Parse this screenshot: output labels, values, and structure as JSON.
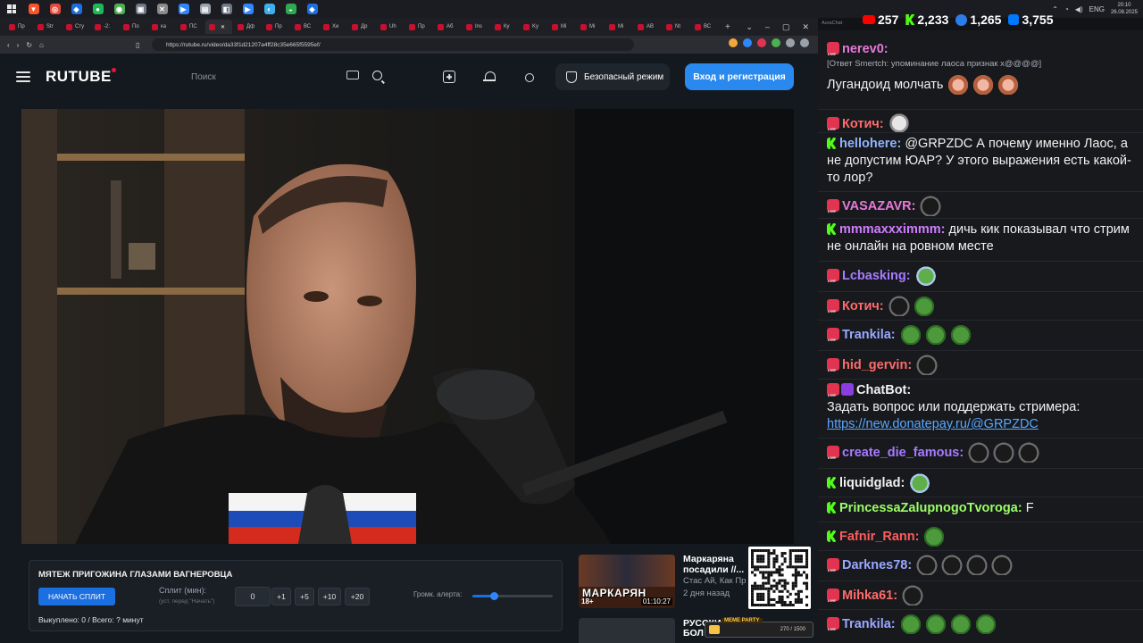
{
  "taskbar": {
    "apps": [
      {
        "glyph": "▼",
        "color": "#fb542b"
      },
      {
        "glyph": "◎",
        "color": "#e64a3b"
      },
      {
        "glyph": "◆",
        "color": "#1c6fe0"
      },
      {
        "glyph": "●",
        "color": "#1db954"
      },
      {
        "glyph": "◉",
        "color": "#4cb050"
      },
      {
        "glyph": "▣",
        "color": "#6f7885"
      },
      {
        "glyph": "✕",
        "color": "#8a8a8a"
      },
      {
        "glyph": "▶",
        "color": "#2f86ff"
      },
      {
        "glyph": "▤",
        "color": "#9aa1aa"
      },
      {
        "glyph": "◧",
        "color": "#6f7885"
      },
      {
        "glyph": "▶",
        "color": "#2f86ff"
      },
      {
        "glyph": "◐",
        "color": "#3db0f0"
      },
      {
        "glyph": "◒",
        "color": "#2fa84f"
      },
      {
        "glyph": "◆",
        "color": "#1c6fe0"
      }
    ],
    "lang": "ENG",
    "time": "20:10",
    "date": "26.08.2025"
  },
  "tabs": [
    {
      "label": "Пр"
    },
    {
      "label": "Str"
    },
    {
      "label": "Сту"
    },
    {
      "label": "-2:"
    },
    {
      "label": "По"
    },
    {
      "label": "ка"
    },
    {
      "label": "ПС"
    },
    {
      "label": "",
      "active": true
    },
    {
      "label": "Дф"
    },
    {
      "label": "Пр"
    },
    {
      "label": "ВС"
    },
    {
      "label": "Хи"
    },
    {
      "label": "Др"
    },
    {
      "label": "Uh"
    },
    {
      "label": "Пр"
    },
    {
      "label": "Аб"
    },
    {
      "label": "Ins"
    },
    {
      "label": "Ку"
    },
    {
      "label": "Kу"
    },
    {
      "label": "Мі"
    },
    {
      "label": "Мі"
    },
    {
      "label": "Мі"
    },
    {
      "label": "АВ"
    },
    {
      "label": "Nt"
    },
    {
      "label": "ВС"
    }
  ],
  "address": {
    "url": "https://rutube.ru/video/da33f1d21207a4ff28c35e665f5595ef/"
  },
  "header": {
    "logo": "RUTUBE",
    "search_placeholder": "Поиск",
    "safe_mode_label": "Безопасный режим",
    "login_label": "Вход и регистрация"
  },
  "split": {
    "title": "МЯТЕЖ ПРИГОЖИНА ГЛАЗАМИ ВАГНЕРОВЦА",
    "start_label": "НАЧАТЬ СПЛИТ",
    "minutes_label": "Сплит (мин):",
    "minutes_hint": "(уст. перед \"Начать\")",
    "minutes_value": "0",
    "increments": [
      "+1",
      "+5",
      "+10",
      "+20"
    ],
    "volume_label": "Громк. алерта:",
    "volume_fraction": 0.27,
    "status": "Выкуплено: 0 / Всего: ? минут"
  },
  "recommended": [
    {
      "title": "Маркаряна посадили //...",
      "channel": "Стас Ай, Как Пр",
      "date": "2 дня назад",
      "thumb_text": "МАРКАРЯН",
      "age": "18+",
      "duration": "01:10:27"
    },
    {
      "title": "РУССКИ БОЛ",
      "thumb_text": ""
    }
  ],
  "party": {
    "label": "MEME PARTY",
    "count": "270 / 1500"
  },
  "chat": {
    "app_label": "AuraChat",
    "stats": [
      {
        "platform": "youtube",
        "value": "257"
      },
      {
        "platform": "kick",
        "value": "2,233"
      },
      {
        "platform": "vk",
        "value": "1,265"
      },
      {
        "platform": "twitch",
        "value": "3,755"
      }
    ],
    "messages": [
      {
        "badge": "live",
        "user": "nerev0:",
        "color": "#e77ad8",
        "reply": "[Ответ Smertch: упоминание лаоса признак х@@@@]",
        "text": "Лугандоид молчать",
        "emotes": [
          "monkey",
          "monkey",
          "monkey"
        ]
      },
      {
        "badge": "live",
        "user": "Котич:",
        "color": "#ff6b6b",
        "text": "",
        "emotes": [
          "cat"
        ]
      },
      {
        "badge": "kick",
        "user": "hellohere:",
        "color": "#8fb4ff",
        "text": "@GRPZDC А почему именно Лаос, а не допустим ЮАР? У этого выражения есть какой-то лор?",
        "emotes": []
      },
      {
        "badge": "live",
        "user": "VASAZAVR:",
        "color": "#e77ad8",
        "text": "",
        "emotes": [
          "black"
        ]
      },
      {
        "badge": "kick",
        "user": "mmmaxxximmm:",
        "color": "#d07dff",
        "text": "дичь кик показывал что стрим не онлайн на ровном месте",
        "emotes": []
      },
      {
        "badge": "live",
        "user": "Lcbasking:",
        "color": "#a77bff",
        "text": "",
        "emotes": [
          "frog2"
        ]
      },
      {
        "badge": "live",
        "user": "Котич:",
        "color": "#ff6b6b",
        "text": "",
        "emotes": [
          "black",
          "frog"
        ]
      },
      {
        "badge": "live",
        "user": "Trankila:",
        "color": "#9aa8ff",
        "text": "",
        "emotes": [
          "frog",
          "frog",
          "frog"
        ]
      },
      {
        "badge": "live",
        "user": "hid_gervin:",
        "color": "#ff6b6b",
        "text": "",
        "emotes": [
          "black"
        ]
      },
      {
        "badge": "live",
        "bot": true,
        "user": "ChatBot:",
        "color": "#f2f2f2",
        "text": "Задать вопрос или поддержать стримера:",
        "link": "https://new.donatepay.ru/@GRPZDC",
        "emotes": []
      },
      {
        "badge": "live",
        "user": "create_die_famous:",
        "color": "#a77bff",
        "text": "",
        "emotes": [
          "black",
          "black",
          "black"
        ]
      },
      {
        "badge": "kick",
        "user": "liquidglad:",
        "color": "#f2f2f2",
        "text": "",
        "emotes": [
          "frog2"
        ]
      },
      {
        "badge": "kick",
        "user": "PrincessaZalupnogoTvoroga:",
        "color": "#9cff66",
        "text": "F",
        "emotes": []
      },
      {
        "badge": "kick",
        "user": "Fafnir_Rann:",
        "color": "#ff5c5c",
        "text": "",
        "emotes": [
          "frog"
        ]
      },
      {
        "badge": "live",
        "user": "Darknes78:",
        "color": "#9aa8ff",
        "text": "",
        "emotes": [
          "black",
          "black",
          "black",
          "black"
        ]
      },
      {
        "badge": "live",
        "user": "Mihka61:",
        "color": "#ff6b6b",
        "text": "",
        "emotes": [
          "black"
        ]
      },
      {
        "badge": "live",
        "user": "Trankila:",
        "color": "#9aa8ff",
        "text": "",
        "emotes": [
          "frog",
          "frog",
          "frog",
          "frog"
        ]
      }
    ]
  }
}
